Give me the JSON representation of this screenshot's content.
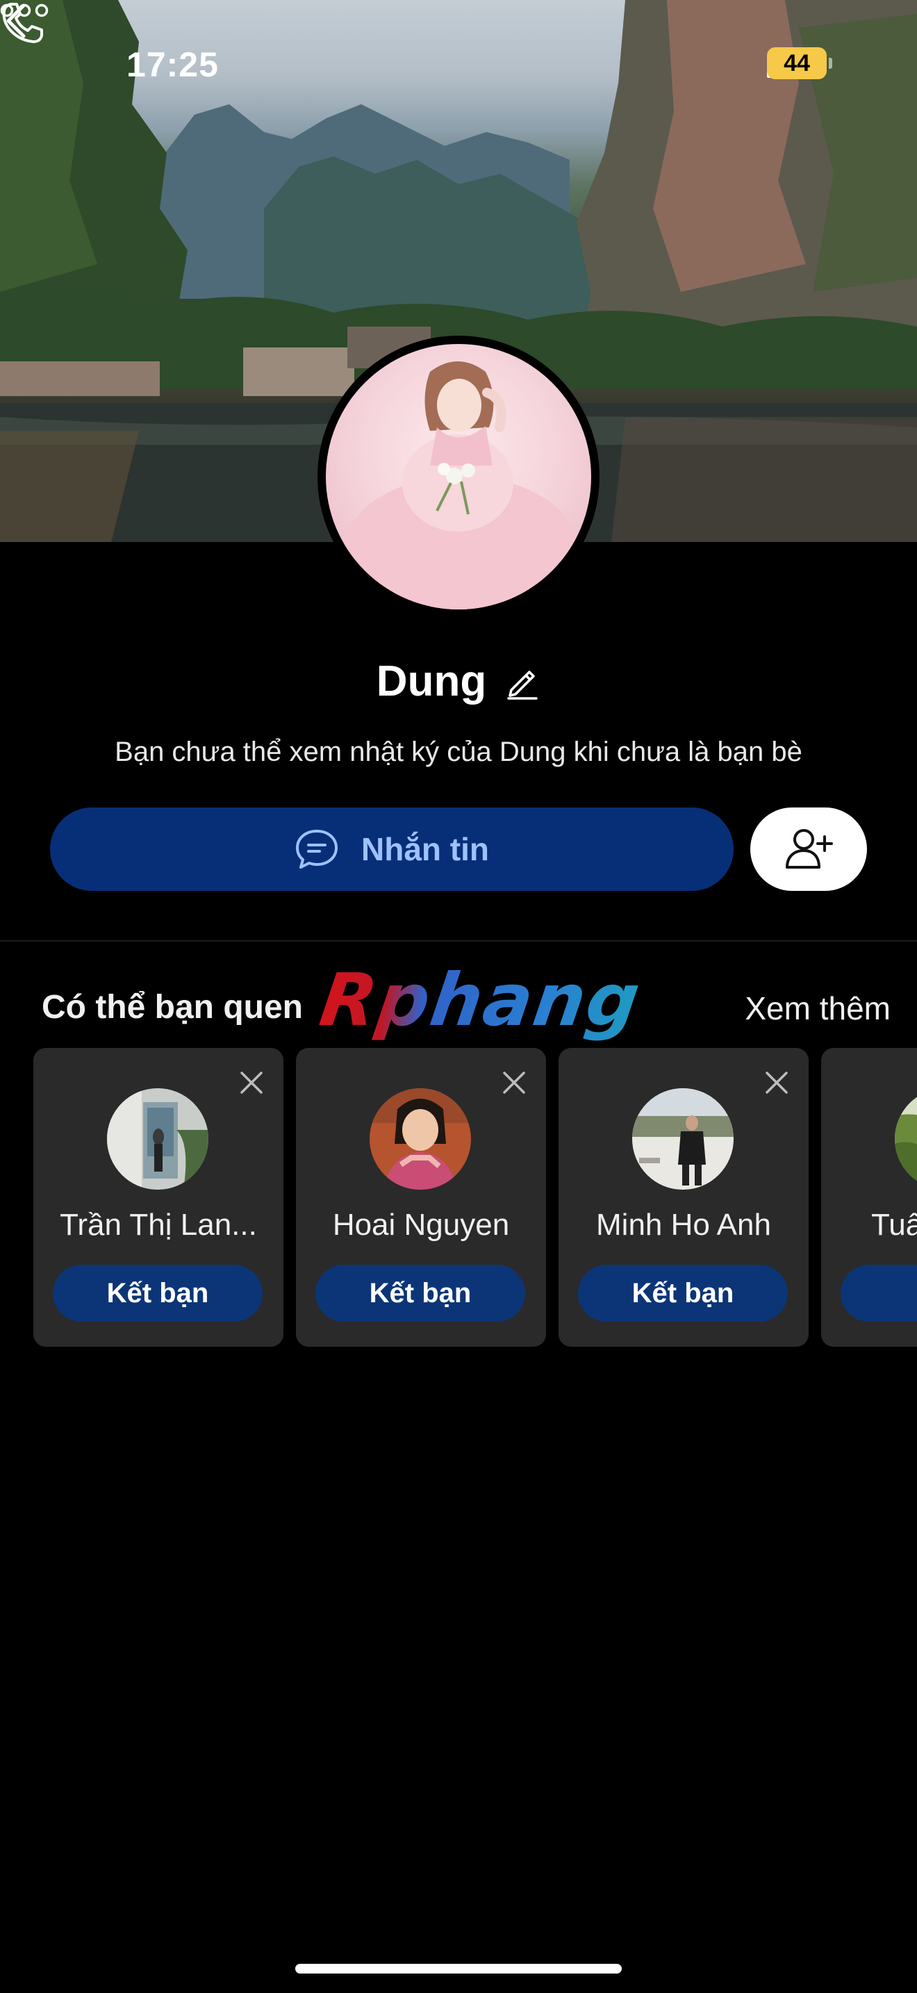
{
  "status_bar": {
    "time": "17:25",
    "battery": "44"
  },
  "nav": {
    "back_icon": "chevron-left-icon",
    "call_icon": "phone-icon",
    "more_icon": "more-dots-icon"
  },
  "profile": {
    "name": "Dung",
    "description": "Bạn chưa thể xem nhật ký của Dung khi chưa là bạn bè"
  },
  "actions": {
    "message_label": "Nhắn tin",
    "add_friend_icon": "add-user-icon"
  },
  "suggestions": {
    "title": "Có thể bạn quen",
    "watermark": "Rphang",
    "see_more": "Xem thêm",
    "items": [
      {
        "name": "Trần Thị Lan...",
        "button": "Kết bạn"
      },
      {
        "name": "Hoai Nguyen",
        "button": "Kết bạn"
      },
      {
        "name": "Minh Ho Anh",
        "button": "Kết bạn"
      },
      {
        "name": "Tuấ",
        "button": "Kế"
      }
    ]
  },
  "colors": {
    "primary_button": "#072f78",
    "primary_label": "#9ec2ff",
    "card_bg": "#2a2a2a",
    "battery": "#f7c948"
  }
}
